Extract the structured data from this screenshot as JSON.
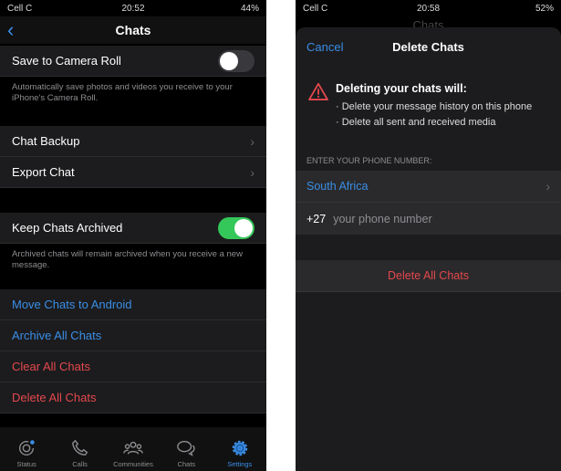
{
  "left": {
    "status": {
      "carrier": "Cell C",
      "time": "20:52",
      "battery": "44%"
    },
    "title": "Chats",
    "save_camera_roll": {
      "label": "Save to Camera Roll",
      "on": false,
      "footer": "Automatically save photos and videos you receive to your iPhone's Camera Roll."
    },
    "backup_rows": [
      {
        "label": "Chat Backup"
      },
      {
        "label": "Export Chat"
      }
    ],
    "keep_archived": {
      "label": "Keep Chats Archived",
      "on": true,
      "footer": "Archived chats will remain archived when you receive a new message."
    },
    "actions": [
      {
        "label": "Move Chats to Android",
        "color": "blue"
      },
      {
        "label": "Archive All Chats",
        "color": "blue"
      },
      {
        "label": "Clear All Chats",
        "color": "red"
      },
      {
        "label": "Delete All Chats",
        "color": "red"
      }
    ],
    "tabs": [
      {
        "label": "Status",
        "icon": "status-icon"
      },
      {
        "label": "Calls",
        "icon": "phone-icon"
      },
      {
        "label": "Communities",
        "icon": "communities-icon"
      },
      {
        "label": "Chats",
        "icon": "chat-bubbles-icon"
      },
      {
        "label": "Settings",
        "icon": "gear-icon",
        "active": true
      }
    ]
  },
  "right": {
    "status": {
      "carrier": "Cell C",
      "time": "20:58",
      "battery": "52%"
    },
    "behind_title": "Chats",
    "sheet": {
      "cancel": "Cancel",
      "title": "Delete Chats",
      "warning_title": "Deleting your chats will:",
      "bullets": [
        "· Delete your message history on this phone",
        "· Delete all sent and received media"
      ],
      "phone_label": "ENTER YOUR PHONE NUMBER:",
      "country": "South Africa",
      "code": "+27",
      "phone_placeholder": "your phone number",
      "delete_button": "Delete All Chats"
    }
  },
  "colors": {
    "accent": "#3a8ee6",
    "danger": "#e5484d",
    "toggle_on": "#34c759"
  }
}
